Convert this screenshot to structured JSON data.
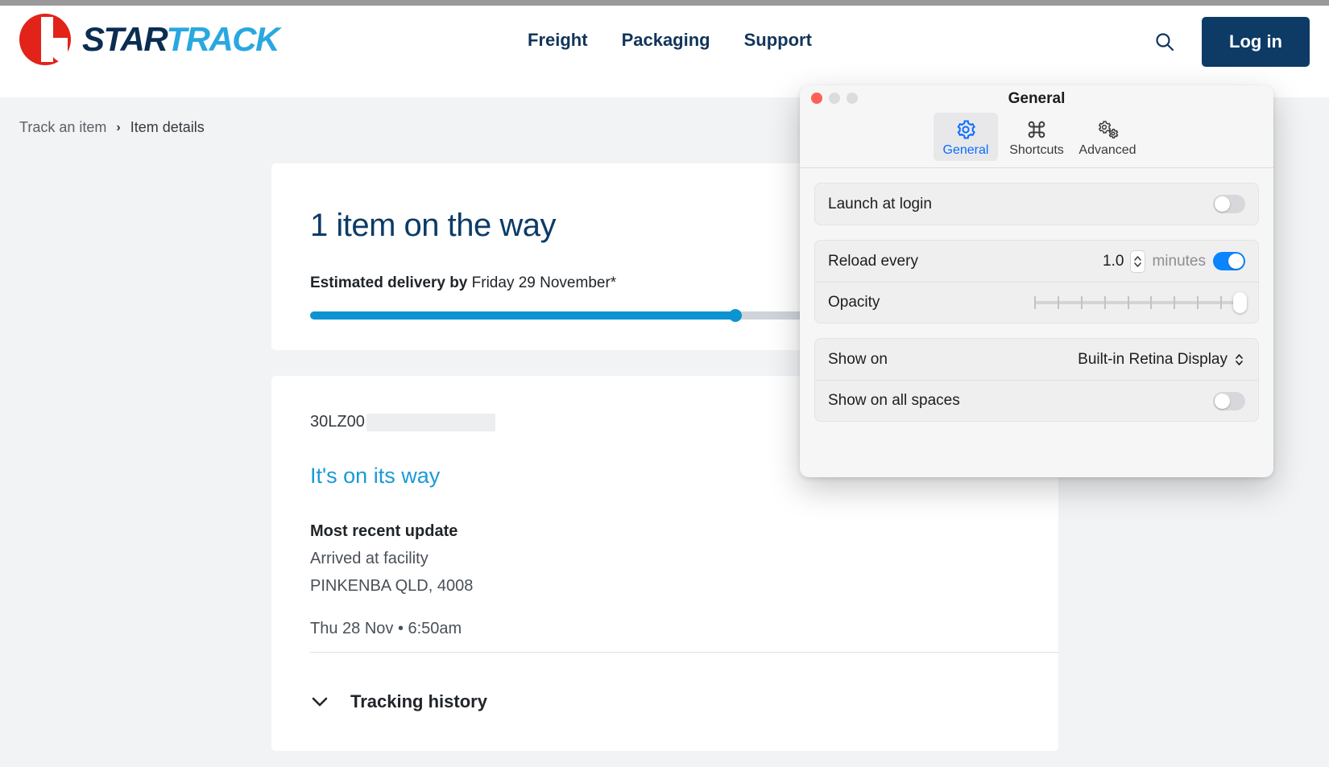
{
  "site": {
    "logo": {
      "star": "STAR",
      "track": "TRACK"
    },
    "nav": [
      {
        "label": "Freight"
      },
      {
        "label": "Packaging"
      },
      {
        "label": "Support"
      }
    ],
    "search_icon": "search-icon",
    "login_label": "Log in"
  },
  "breadcrumb": {
    "parent": "Track an item",
    "separator": "›",
    "current": "Item details"
  },
  "summary": {
    "headline": "1 item on the way",
    "eta_label": "Estimated delivery by",
    "eta_value": "Friday 29 November*",
    "progress_percent": 60
  },
  "detail": {
    "tracking_number": "30LZ00",
    "status": "It's on its way",
    "update_title": "Most recent update",
    "update_event": "Arrived at facility",
    "update_location": "PINKENBA QLD, 4008",
    "update_time": "Thu 28 Nov • 6:50am",
    "history_label": "Tracking history",
    "history_chevron": "chevron-down-icon"
  },
  "prefs": {
    "title": "General",
    "window_controls": [
      "close-button",
      "minimize-button",
      "zoom-button"
    ],
    "tabs": [
      {
        "label": "General",
        "icon": "gear-icon",
        "active": true
      },
      {
        "label": "Shortcuts",
        "icon": "command-key-icon",
        "active": false
      },
      {
        "label": "Advanced",
        "icon": "double-gear-icon",
        "active": false
      }
    ],
    "rows": {
      "launch_at_login": {
        "label": "Launch at login",
        "toggle": "off"
      },
      "reload_every": {
        "label": "Reload every",
        "value": "1.0",
        "unit": "minutes",
        "toggle": "on"
      },
      "opacity": {
        "label": "Opacity",
        "value_percent": 100,
        "ticks": 10
      },
      "show_on": {
        "label": "Show on",
        "value": "Built-in Retina Display"
      },
      "show_on_all_spaces": {
        "label": "Show on all spaces",
        "toggle": "off"
      }
    }
  },
  "colors": {
    "brand_navy": "#0d3b66",
    "brand_red": "#e2231a",
    "brand_blue": "#29a8e0",
    "progress_blue": "#0c93d2",
    "status_blue": "#1a9ad7",
    "toggle_on": "#0a84ff",
    "tab_active": "#0a6cff",
    "page_bg": "#f1f3f5"
  }
}
